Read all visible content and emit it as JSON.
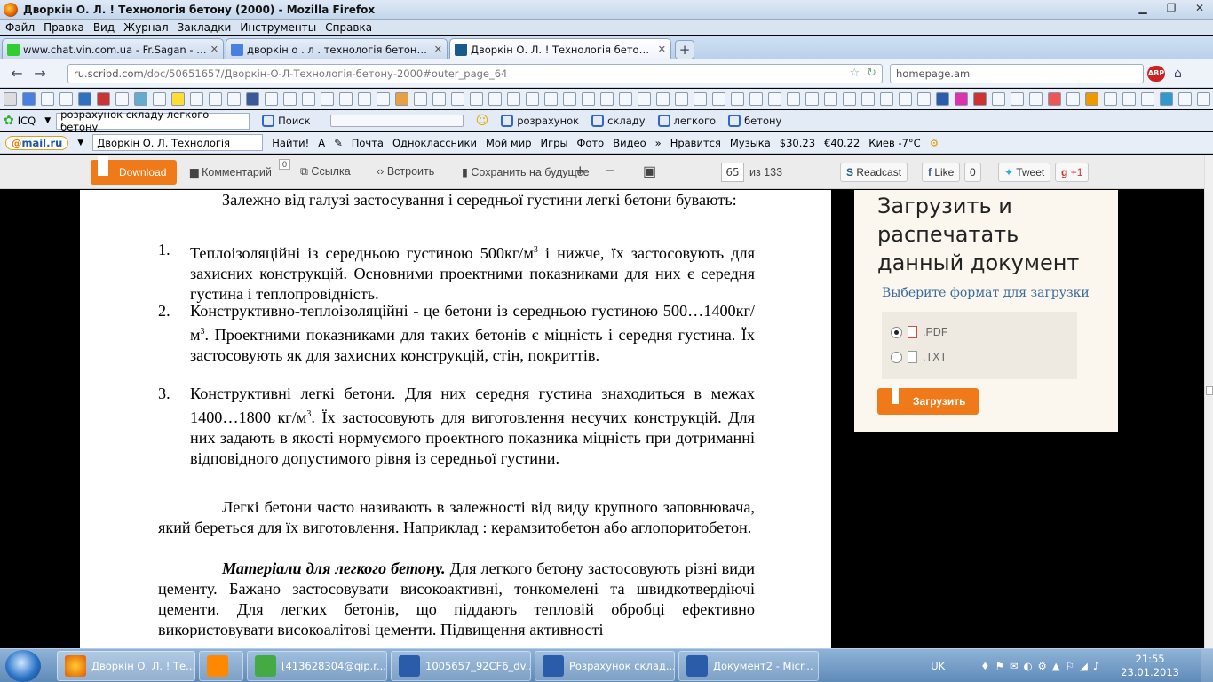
{
  "window": {
    "title": "Дворкін О. Л. ! Технологія бетону (2000) - Mozilla Firefox"
  },
  "menu": [
    "Файл",
    "Правка",
    "Вид",
    "Журнал",
    "Закладки",
    "Инструменты",
    "Справка"
  ],
  "tabs": [
    {
      "label": "www.chat.vin.com.ua - Fr.Sagan - Вин...",
      "active": false
    },
    {
      "label": "дворкін о . л . технологія бетону - По...",
      "active": false
    },
    {
      "label": "Дворкін О. Л. ! Технологія бетону (20...",
      "active": true
    }
  ],
  "nav": {
    "url_site": "ru.scribd.com",
    "url_path": "/doc/50651657/Дворкін-О-Л-Технологія-бетону-2000#outer_page_64",
    "search_value": "homepage.am"
  },
  "icq": {
    "label": "ICQ",
    "input_value": "розрахунок складу легкого бетону",
    "search_label": "Поиск",
    "terms": [
      "розрахунок",
      "складу",
      "легкого",
      "бетону"
    ]
  },
  "mailbar": {
    "brand_at": "@",
    "brand": "mail.ru",
    "search_value": "Дворкін   О. Л. Технологія",
    "find_label": "Найти!",
    "links": [
      "Почта",
      "Одноклассники",
      "Мой мир",
      "Игры",
      "Фото",
      "Видео"
    ],
    "more": "»",
    "like": "Нравится",
    "music": "Музыка",
    "usd": "$30.23",
    "eur": "€40.22",
    "weather": "Киев -7°C"
  },
  "scribd": {
    "download": "Download",
    "comments": "Комментарий",
    "comments_count": "0",
    "link": "Ссылка",
    "embed": "Встроить",
    "save": "Сохранить на будущее",
    "page": "65",
    "page_of": "из 133",
    "readcast": "Readcast",
    "like": "Like",
    "like_count": "0",
    "tweet": "Tweet",
    "gplus": "+1"
  },
  "document": {
    "intro": "Залежно від галузі застосування і середньої густини легкі бетони бувають:",
    "items": [
      {
        "num": "1.",
        "text_a": "Теплоізоляційні із середньою густиною 500кг/м",
        "sup": "3",
        "text_b": " і нижче, їх застосовують для захисних конструкцій. Основними проектними показниками для них є середня густина і теплопровідність."
      },
      {
        "num": "2.",
        "text_a": "Конструктивно-теплоізоляційні - це бетони із середньою густиною 500…1400кг/м",
        "sup": "3",
        "text_b": ". Проектними показниками для таких бетонів є міцність і середня густина. Їх застосовують як для захисних конструкцій, стін, покриттів."
      },
      {
        "num": "3.",
        "text_a": "Конструктивні легкі бетони. Для них середня густина знаходиться в межах 1400…1800 кг/м",
        "sup": "3",
        "text_b": ". Їх застосовують для виготовлення несучих конструкцій. Для них задають в якості нормуємого проектного показника міцність при дотриманні відповідного допустимого рівня із середньої густини."
      }
    ],
    "para2": "Легкі бетони часто називають в залежності від виду крупного заповнювача, який береться для їх виготовлення. Наприклад : керамзитобетон або аглопоритобетон.",
    "para3_bold": "Матеріали для легкого бетону.",
    "para3": " Для легкого бетону застосовують різні види цементу. Бажано застосовувати високоактивні, тонкомелені та швидкотвердіючі цементи. Для легких бетонів, що піддають тепловій обробці ефективно використовувати високоалітові цементи. Підвищення активності"
  },
  "panel": {
    "title": "Загрузить и распечатать данный документ",
    "subtitle": "Выберите формат для загрузки",
    "formats": [
      ".PDF",
      ".TXT"
    ],
    "selected": ".PDF",
    "upload": "Загрузить"
  },
  "taskbar": {
    "tasks": [
      "Дворкін О. Л. ! Те...",
      "",
      "[413628304@qip.r...",
      "1005657_92CF6_dv...",
      "Розрахунок склад...",
      "Документ2 - Micr..."
    ],
    "lang": "UK",
    "time": "21:55",
    "date": "23.01.2013"
  }
}
